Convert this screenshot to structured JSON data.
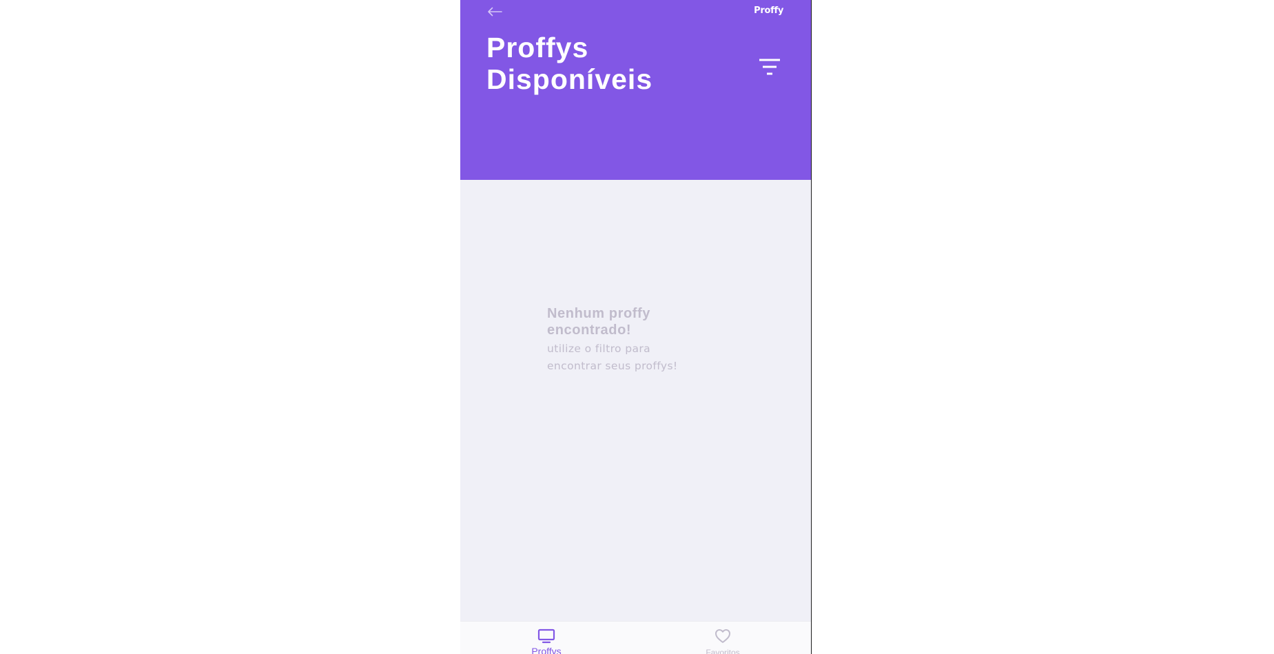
{
  "header": {
    "brand": "Proffy",
    "title": "Proffys Disponíveis",
    "back_icon": "arrow-left-icon",
    "filter_icon": "filter-icon"
  },
  "empty_state": {
    "title": "Nenhum proffy encontrado!",
    "subtitle": "utilize o filtro para encontrar seus proffys!"
  },
  "tabbar": {
    "tabs": [
      {
        "label": "Proffys",
        "icon": "tv-icon",
        "active": true
      },
      {
        "label": "Favoritos",
        "icon": "heart-icon",
        "active": false
      }
    ]
  },
  "colors": {
    "primary": "#8257e5",
    "background": "#f0f0f7",
    "muted_text": "#c1bccc",
    "tabbar_bg": "#fafafc"
  }
}
